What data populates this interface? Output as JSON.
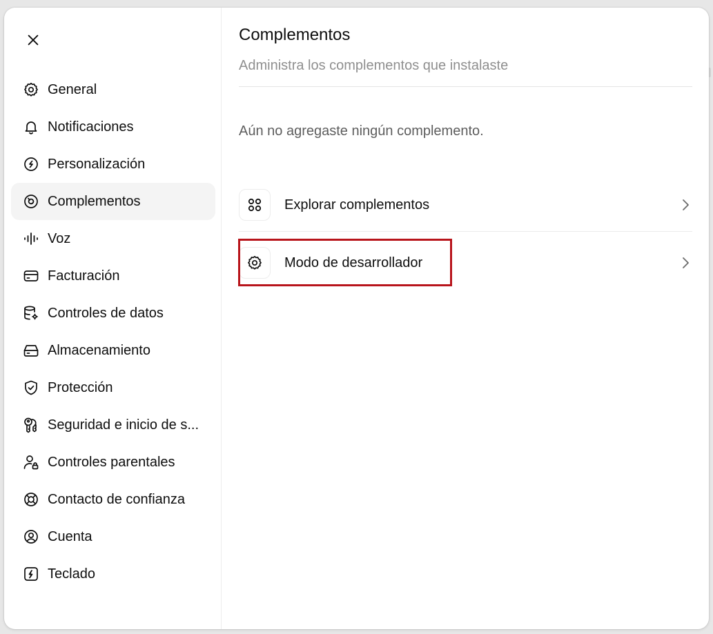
{
  "window": {
    "close_icon": "close-icon"
  },
  "sidebar": {
    "items": [
      {
        "id": "general",
        "label": "General",
        "icon": "gear-icon",
        "active": false
      },
      {
        "id": "notifications",
        "label": "Notificaciones",
        "icon": "bell-icon",
        "active": false
      },
      {
        "id": "personalization",
        "label": "Personalización",
        "icon": "palette-icon",
        "active": false
      },
      {
        "id": "complements",
        "label": "Complementos",
        "icon": "plugin-icon",
        "active": true
      },
      {
        "id": "voice",
        "label": "Voz",
        "icon": "waveform-icon",
        "active": false
      },
      {
        "id": "billing",
        "label": "Facturación",
        "icon": "credit-card-icon",
        "active": false
      },
      {
        "id": "data-controls",
        "label": "Controles de datos",
        "icon": "database-gear-icon",
        "active": false
      },
      {
        "id": "storage",
        "label": "Almacenamiento",
        "icon": "storage-drive-icon",
        "active": false
      },
      {
        "id": "protection",
        "label": "Protección",
        "icon": "shield-check-icon",
        "active": false
      },
      {
        "id": "security",
        "label": "Seguridad e inicio de s...",
        "icon": "key-icon",
        "active": false
      },
      {
        "id": "parental",
        "label": "Controles parentales",
        "icon": "user-lock-icon",
        "active": false
      },
      {
        "id": "trusted-contact",
        "label": "Contacto de confianza",
        "icon": "lifebuoy-icon",
        "active": false
      },
      {
        "id": "account",
        "label": "Cuenta",
        "icon": "user-circle-icon",
        "active": false
      },
      {
        "id": "keyboard",
        "label": "Teclado",
        "icon": "bolt-square-icon",
        "active": false
      }
    ]
  },
  "main": {
    "title": "Complementos",
    "subtitle": "Administra los complementos que instalaste",
    "empty_message": "Aún no agregaste ningún complemento.",
    "rows": {
      "explore": {
        "label": "Explorar complementos",
        "icon": "apps-grid-icon"
      },
      "developer": {
        "label": "Modo de desarrollador",
        "icon": "gear-icon"
      }
    }
  },
  "colors": {
    "highlight": "#b8141b",
    "active_bg": "#f4f4f4",
    "subtitle": "#8f8f8f"
  }
}
